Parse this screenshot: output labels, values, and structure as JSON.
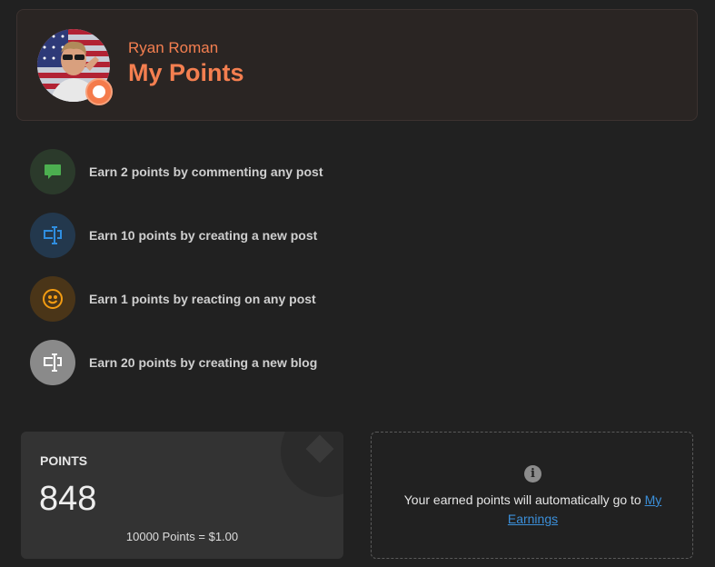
{
  "header": {
    "user_name": "Ryan Roman",
    "title": "My Points"
  },
  "earn_items": [
    {
      "label": "Earn 2 points by commenting any post",
      "icon": "comment-icon",
      "bg": "#2b3a2b",
      "color": "#4caf50"
    },
    {
      "label": "Earn 10 points by creating a new post",
      "icon": "text-cursor-icon",
      "bg": "#23384d",
      "color": "#2f8ee0"
    },
    {
      "label": "Earn 1 points by reacting on any post",
      "icon": "smiley-icon",
      "bg": "#4a3518",
      "color": "#f39c12"
    },
    {
      "label": "Earn 20 points by creating a new blog",
      "icon": "text-cursor-icon",
      "bg": "#8a8a8a",
      "color": "#ffffff"
    }
  ],
  "points": {
    "heading": "POINTS",
    "value": "848",
    "rate": "10000 Points = $1.00"
  },
  "info": {
    "text": "Your earned points will automatically go to",
    "link_text": "My Earnings"
  }
}
